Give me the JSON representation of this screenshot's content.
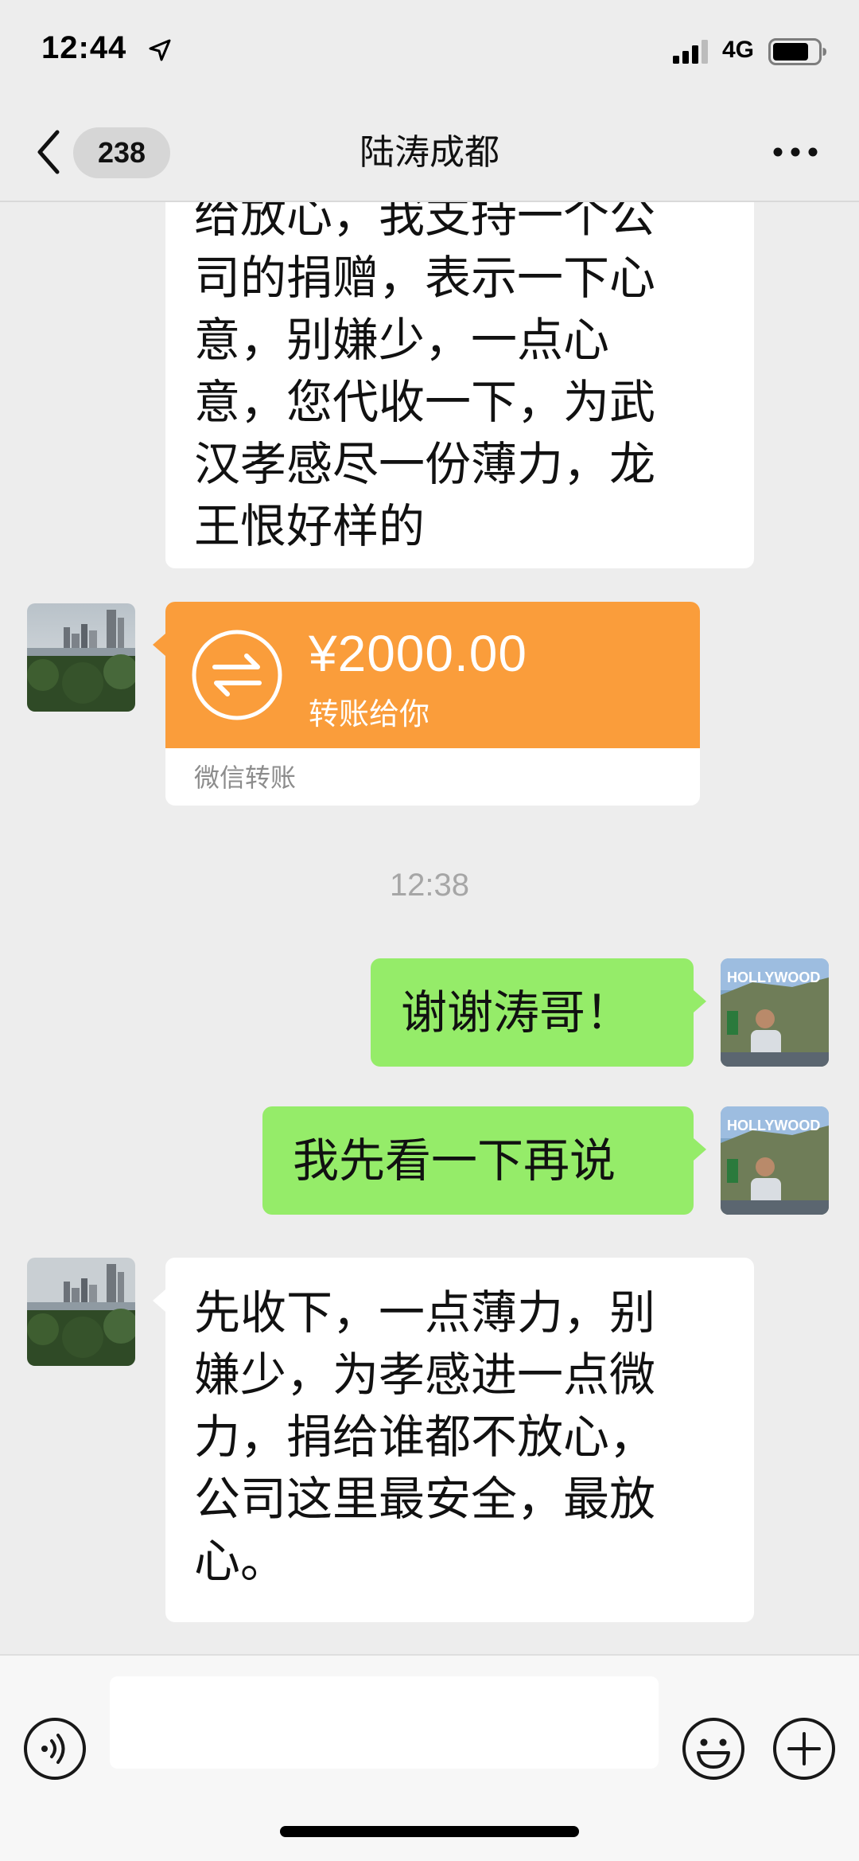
{
  "status_bar": {
    "time": "12:44",
    "network": "4G",
    "icons": [
      "location-arrow-icon",
      "signal-bars-icon",
      "battery-icon"
    ]
  },
  "nav": {
    "back_icon": "chevron-left-icon",
    "unread_count": "238",
    "title": "陆涛成都",
    "more_icon": "ellipsis-icon"
  },
  "messages": [
    {
      "side": "left",
      "type": "text",
      "text": "给放心，我支持一个公\n司的捐赠，表示一下心\n意，别嫌少，一点心\n意，您代收一下，为武\n汉孝感尽一份薄力，龙\n王恨好样的"
    },
    {
      "side": "left",
      "type": "transfer",
      "amount": "¥2000.00",
      "description": "转账给你",
      "footer": "微信转账"
    },
    {
      "type": "timestamp",
      "text": "12:38"
    },
    {
      "side": "right",
      "type": "text",
      "text": "谢谢涛哥！"
    },
    {
      "side": "right",
      "type": "text",
      "text": "我先看一下再说"
    },
    {
      "side": "left",
      "type": "text",
      "text": "先收下，一点薄力，别\n嫌少，为孝感进一点微\n力，捐给谁都不放心，\n公司这里最安全，最放\n心。"
    }
  ],
  "input_bar": {
    "placeholder": "",
    "icons": [
      "voice-icon",
      "emoji-icon",
      "plus-icon"
    ]
  },
  "colors": {
    "background": "#ededed",
    "bubble_self": "#95ec69",
    "bubble_other": "#ffffff",
    "transfer": "#fa9d3b",
    "timestamp": "#a6a6a6"
  }
}
